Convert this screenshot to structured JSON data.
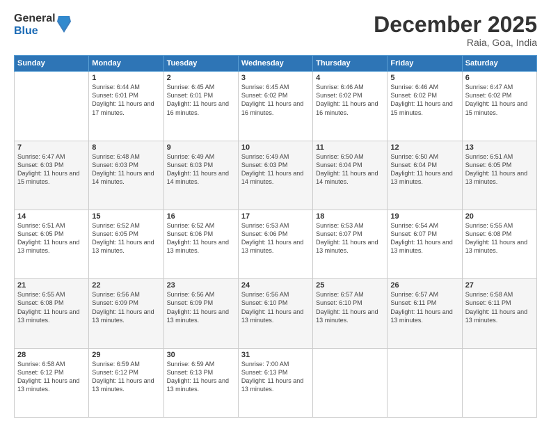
{
  "header": {
    "logo_general": "General",
    "logo_blue": "Blue",
    "month_title": "December 2025",
    "location": "Raia, Goa, India"
  },
  "days_of_week": [
    "Sunday",
    "Monday",
    "Tuesday",
    "Wednesday",
    "Thursday",
    "Friday",
    "Saturday"
  ],
  "weeks": [
    [
      {
        "day": "",
        "sunrise": "",
        "sunset": "",
        "daylight": ""
      },
      {
        "day": "1",
        "sunrise": "Sunrise: 6:44 AM",
        "sunset": "Sunset: 6:01 PM",
        "daylight": "Daylight: 11 hours and 17 minutes."
      },
      {
        "day": "2",
        "sunrise": "Sunrise: 6:45 AM",
        "sunset": "Sunset: 6:01 PM",
        "daylight": "Daylight: 11 hours and 16 minutes."
      },
      {
        "day": "3",
        "sunrise": "Sunrise: 6:45 AM",
        "sunset": "Sunset: 6:02 PM",
        "daylight": "Daylight: 11 hours and 16 minutes."
      },
      {
        "day": "4",
        "sunrise": "Sunrise: 6:46 AM",
        "sunset": "Sunset: 6:02 PM",
        "daylight": "Daylight: 11 hours and 16 minutes."
      },
      {
        "day": "5",
        "sunrise": "Sunrise: 6:46 AM",
        "sunset": "Sunset: 6:02 PM",
        "daylight": "Daylight: 11 hours and 15 minutes."
      },
      {
        "day": "6",
        "sunrise": "Sunrise: 6:47 AM",
        "sunset": "Sunset: 6:02 PM",
        "daylight": "Daylight: 11 hours and 15 minutes."
      }
    ],
    [
      {
        "day": "7",
        "sunrise": "Sunrise: 6:47 AM",
        "sunset": "Sunset: 6:03 PM",
        "daylight": "Daylight: 11 hours and 15 minutes."
      },
      {
        "day": "8",
        "sunrise": "Sunrise: 6:48 AM",
        "sunset": "Sunset: 6:03 PM",
        "daylight": "Daylight: 11 hours and 14 minutes."
      },
      {
        "day": "9",
        "sunrise": "Sunrise: 6:49 AM",
        "sunset": "Sunset: 6:03 PM",
        "daylight": "Daylight: 11 hours and 14 minutes."
      },
      {
        "day": "10",
        "sunrise": "Sunrise: 6:49 AM",
        "sunset": "Sunset: 6:03 PM",
        "daylight": "Daylight: 11 hours and 14 minutes."
      },
      {
        "day": "11",
        "sunrise": "Sunrise: 6:50 AM",
        "sunset": "Sunset: 6:04 PM",
        "daylight": "Daylight: 11 hours and 14 minutes."
      },
      {
        "day": "12",
        "sunrise": "Sunrise: 6:50 AM",
        "sunset": "Sunset: 6:04 PM",
        "daylight": "Daylight: 11 hours and 13 minutes."
      },
      {
        "day": "13",
        "sunrise": "Sunrise: 6:51 AM",
        "sunset": "Sunset: 6:05 PM",
        "daylight": "Daylight: 11 hours and 13 minutes."
      }
    ],
    [
      {
        "day": "14",
        "sunrise": "Sunrise: 6:51 AM",
        "sunset": "Sunset: 6:05 PM",
        "daylight": "Daylight: 11 hours and 13 minutes."
      },
      {
        "day": "15",
        "sunrise": "Sunrise: 6:52 AM",
        "sunset": "Sunset: 6:05 PM",
        "daylight": "Daylight: 11 hours and 13 minutes."
      },
      {
        "day": "16",
        "sunrise": "Sunrise: 6:52 AM",
        "sunset": "Sunset: 6:06 PM",
        "daylight": "Daylight: 11 hours and 13 minutes."
      },
      {
        "day": "17",
        "sunrise": "Sunrise: 6:53 AM",
        "sunset": "Sunset: 6:06 PM",
        "daylight": "Daylight: 11 hours and 13 minutes."
      },
      {
        "day": "18",
        "sunrise": "Sunrise: 6:53 AM",
        "sunset": "Sunset: 6:07 PM",
        "daylight": "Daylight: 11 hours and 13 minutes."
      },
      {
        "day": "19",
        "sunrise": "Sunrise: 6:54 AM",
        "sunset": "Sunset: 6:07 PM",
        "daylight": "Daylight: 11 hours and 13 minutes."
      },
      {
        "day": "20",
        "sunrise": "Sunrise: 6:55 AM",
        "sunset": "Sunset: 6:08 PM",
        "daylight": "Daylight: 11 hours and 13 minutes."
      }
    ],
    [
      {
        "day": "21",
        "sunrise": "Sunrise: 6:55 AM",
        "sunset": "Sunset: 6:08 PM",
        "daylight": "Daylight: 11 hours and 13 minutes."
      },
      {
        "day": "22",
        "sunrise": "Sunrise: 6:56 AM",
        "sunset": "Sunset: 6:09 PM",
        "daylight": "Daylight: 11 hours and 13 minutes."
      },
      {
        "day": "23",
        "sunrise": "Sunrise: 6:56 AM",
        "sunset": "Sunset: 6:09 PM",
        "daylight": "Daylight: 11 hours and 13 minutes."
      },
      {
        "day": "24",
        "sunrise": "Sunrise: 6:56 AM",
        "sunset": "Sunset: 6:10 PM",
        "daylight": "Daylight: 11 hours and 13 minutes."
      },
      {
        "day": "25",
        "sunrise": "Sunrise: 6:57 AM",
        "sunset": "Sunset: 6:10 PM",
        "daylight": "Daylight: 11 hours and 13 minutes."
      },
      {
        "day": "26",
        "sunrise": "Sunrise: 6:57 AM",
        "sunset": "Sunset: 6:11 PM",
        "daylight": "Daylight: 11 hours and 13 minutes."
      },
      {
        "day": "27",
        "sunrise": "Sunrise: 6:58 AM",
        "sunset": "Sunset: 6:11 PM",
        "daylight": "Daylight: 11 hours and 13 minutes."
      }
    ],
    [
      {
        "day": "28",
        "sunrise": "Sunrise: 6:58 AM",
        "sunset": "Sunset: 6:12 PM",
        "daylight": "Daylight: 11 hours and 13 minutes."
      },
      {
        "day": "29",
        "sunrise": "Sunrise: 6:59 AM",
        "sunset": "Sunset: 6:12 PM",
        "daylight": "Daylight: 11 hours and 13 minutes."
      },
      {
        "day": "30",
        "sunrise": "Sunrise: 6:59 AM",
        "sunset": "Sunset: 6:13 PM",
        "daylight": "Daylight: 11 hours and 13 minutes."
      },
      {
        "day": "31",
        "sunrise": "Sunrise: 7:00 AM",
        "sunset": "Sunset: 6:13 PM",
        "daylight": "Daylight: 11 hours and 13 minutes."
      },
      {
        "day": "",
        "sunrise": "",
        "sunset": "",
        "daylight": ""
      },
      {
        "day": "",
        "sunrise": "",
        "sunset": "",
        "daylight": ""
      },
      {
        "day": "",
        "sunrise": "",
        "sunset": "",
        "daylight": ""
      }
    ]
  ]
}
